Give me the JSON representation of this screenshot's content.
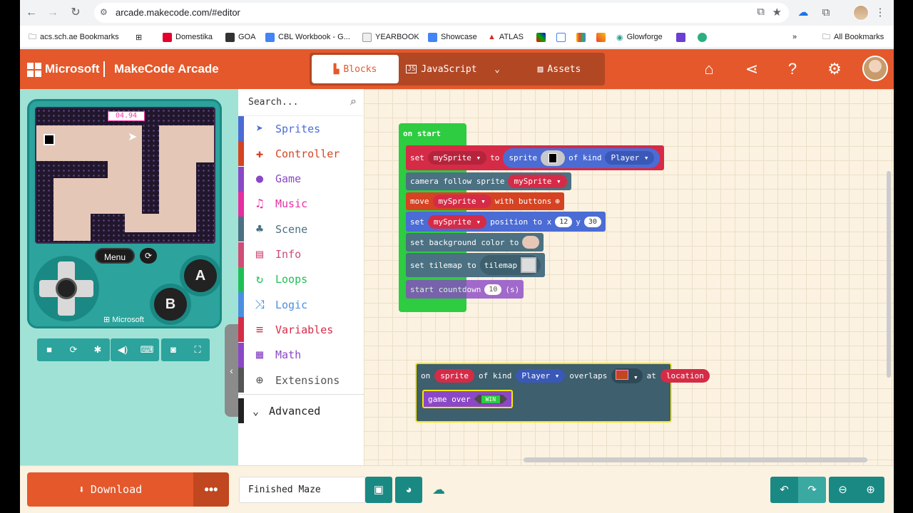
{
  "browser": {
    "url": "arcade.makecode.com/#editor",
    "bookmarks": [
      "acs.sch.ae Bookmarks",
      "Domestika",
      "GOA",
      "CBL Workbook - G...",
      "YEARBOOK",
      "Showcase",
      "ATLAS",
      "Glowforge"
    ],
    "all_bookmarks": "All Bookmarks",
    "more": "»"
  },
  "header": {
    "brand": "Microsoft",
    "app_title": "MakeCode Arcade",
    "tabs": [
      {
        "label": "Blocks",
        "icon": "puzzle-icon"
      },
      {
        "label": "JavaScript",
        "icon": "js-icon"
      },
      {
        "label": "Assets",
        "icon": "image-icon"
      }
    ]
  },
  "simulator": {
    "countdown": "04.94",
    "menu": "Menu",
    "a": "A",
    "b": "B",
    "console_brand": "Microsoft"
  },
  "toolbox": {
    "search_placeholder": "Search...",
    "categories": [
      {
        "label": "Sprites",
        "color": "#4b6cd5",
        "icon": "paper-plane-icon"
      },
      {
        "label": "Controller",
        "color": "#d54322",
        "icon": "gamepad-icon"
      },
      {
        "label": "Game",
        "color": "#8b48c6",
        "icon": "circle-icon"
      },
      {
        "label": "Music",
        "color": "#e52fa1",
        "icon": "headphones-icon"
      },
      {
        "label": "Scene",
        "color": "#4b7182",
        "icon": "tree-icon"
      },
      {
        "label": "Info",
        "color": "#cf4d77",
        "icon": "id-card-icon"
      },
      {
        "label": "Loops",
        "color": "#20bf55",
        "icon": "refresh-icon"
      },
      {
        "label": "Logic",
        "color": "#4b8fe0",
        "icon": "shuffle-icon"
      },
      {
        "label": "Variables",
        "color": "#d52b47",
        "icon": "list-icon"
      },
      {
        "label": "Math",
        "color": "#8b48c6",
        "icon": "calculator-icon"
      },
      {
        "label": "Extensions",
        "color": "#555555",
        "icon": "plus-circle-icon"
      }
    ],
    "advanced": "Advanced"
  },
  "workspace": {
    "on_start": {
      "hat": "on start",
      "set": "set",
      "var": "mySprite",
      "to": "to",
      "sprite": "sprite",
      "of_kind": "of kind",
      "kind": "Player",
      "camera": "camera follow sprite",
      "move": "move",
      "with_buttons": "with buttons",
      "position_to_x": "position to x",
      "x": "12",
      "y_label": "y",
      "y": "30",
      "bg_color": "set background color to",
      "set_tilemap": "set tilemap to",
      "tilemap": "tilemap",
      "countdown": "start countdown",
      "seconds": "10",
      "s": "(s)"
    },
    "overlaps": {
      "on": "on",
      "sprite": "sprite",
      "of_kind": "of kind",
      "kind": "Player",
      "overlaps": "overlaps",
      "at": "at",
      "location": "location",
      "game_over": "game over",
      "win": "WIN"
    }
  },
  "footer": {
    "download": "Download",
    "more": "•••",
    "project_name": "Finished Maze"
  }
}
